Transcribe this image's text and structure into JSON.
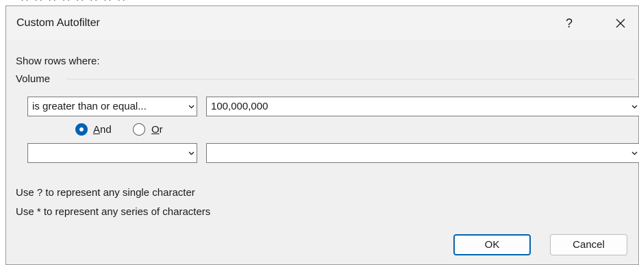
{
  "background_peek": {
    "text": "·· ·· ·· ·· ·· ·· ·· ··"
  },
  "dialog": {
    "title": "Custom Autofilter",
    "help_label": "?",
    "show_rows_label": "Show rows where:",
    "column_name": "Volume",
    "criteria1": {
      "operator": "is greater than or equal...",
      "value": "100,000,000"
    },
    "logic": {
      "and_label": "And",
      "and_accel": "A",
      "and_rest": "nd",
      "or_label": "Or",
      "or_accel": "O",
      "or_rest": "r",
      "selected": "and"
    },
    "criteria2": {
      "operator": "",
      "value": ""
    },
    "hint1": "Use ? to represent any single character",
    "hint2": "Use * to represent any series of characters",
    "ok_label": "OK",
    "cancel_label": "Cancel"
  },
  "colors": {
    "accent": "#0063b1",
    "dialog_bg": "#f0f0f0",
    "text": "#1a1a1a"
  },
  "icons": {
    "close": "close-icon",
    "dropdown": "chevron-down-icon"
  }
}
